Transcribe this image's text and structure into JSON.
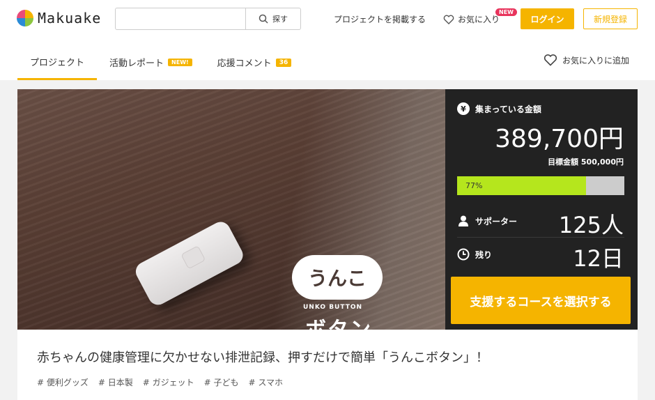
{
  "header": {
    "logo_text": "Makuake",
    "search": {
      "placeholder": "",
      "button_label": "探す"
    },
    "nav": {
      "post_project": "プロジェクトを掲載する",
      "favorites": "お気に入り",
      "favorites_badge": "NEW",
      "login": "ログイン",
      "register": "新規登録"
    }
  },
  "tabs": [
    {
      "label": "プロジェクト",
      "active": true
    },
    {
      "label": "活動レポート",
      "badge": "NEW!"
    },
    {
      "label": "応援コメント",
      "count": "36"
    }
  ],
  "favorite_add_label": "お気に入りに追加",
  "hero": {
    "brand_bubble": "うんこ",
    "brand_sub": "UNKO BUTTON",
    "brand_main": "ボタン"
  },
  "stats": {
    "raised_label": "集まっている金額",
    "raised_amount": "389,700円",
    "goal_label": "目標金額 500,000円",
    "progress_text": "77%",
    "progress_value": 0.77,
    "supporters_label": "サポーター",
    "supporters_value": "125人",
    "remaining_label": "残り",
    "remaining_value": "12日",
    "cta_label": "支援するコースを選択する"
  },
  "project": {
    "title": "赤ちゃんの健康管理に欠かせない排泄記録、押すだけで簡単「うんこボタン」！",
    "hashtags": [
      "# 便利グッズ",
      "# 日本製",
      "# ガジェット",
      "# 子ども",
      "# スマホ"
    ]
  },
  "colors": {
    "accent": "#f5b400",
    "progress": "#b5e61d",
    "new_badge": "#e8345c",
    "panel": "#222222"
  }
}
